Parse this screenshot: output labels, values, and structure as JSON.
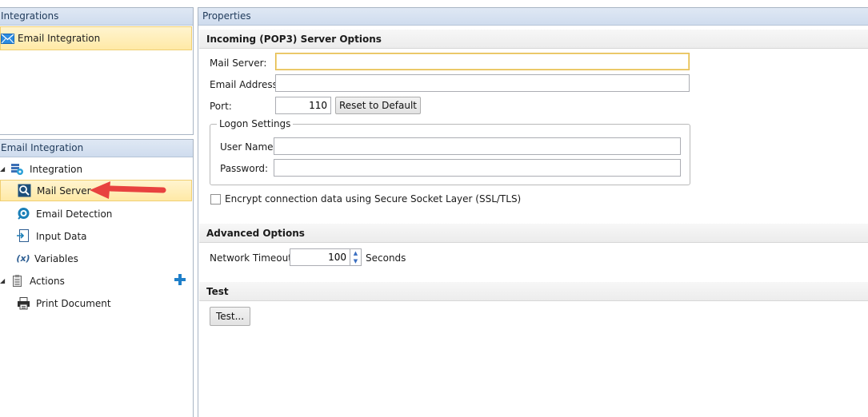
{
  "integrations_panel": {
    "header": "Integrations",
    "item": {
      "label": "Email Integration",
      "icon": "envelope-icon"
    }
  },
  "tree_panel": {
    "header": "Email Integration",
    "items": [
      {
        "label": "Integration",
        "icon": "integration-icon",
        "expanded": true
      },
      {
        "label": "Mail Server",
        "icon": "mail-server-icon",
        "selected": true
      },
      {
        "label": "Email Detection",
        "icon": "email-detection-icon"
      },
      {
        "label": "Input Data",
        "icon": "input-data-icon"
      },
      {
        "label": "Variables",
        "icon": "variables-icon"
      },
      {
        "label": "Actions",
        "icon": "actions-icon",
        "expanded": true
      },
      {
        "label": "Print Document",
        "icon": "printer-icon"
      }
    ]
  },
  "properties": {
    "header": "Properties",
    "incoming": {
      "title": "Incoming (POP3) Server Options",
      "mail_server_label": "Mail Server:",
      "mail_server_value": "",
      "email_address_label": "Email Address:",
      "email_address_value": "",
      "port_label": "Port:",
      "port_value": "110",
      "reset_button": "Reset to Default",
      "logon_title": "Logon Settings",
      "username_label": "User Name:",
      "username_value": "",
      "password_label": "Password:",
      "password_value": "",
      "ssl_label": "Encrypt connection data using Secure Socket Layer (SSL/TLS)",
      "ssl_checked": false
    },
    "advanced": {
      "title": "Advanced Options",
      "timeout_label": "Network Timeout:",
      "timeout_value": "100",
      "timeout_unit": "Seconds"
    },
    "test": {
      "title": "Test",
      "button": "Test..."
    }
  },
  "colors": {
    "selection_fill": "#ffe9a6",
    "selection_border": "#f0cf72",
    "header_fill": "#cfdcee",
    "arrow": "#e8423f",
    "accent_blue": "#1f7fc9"
  }
}
